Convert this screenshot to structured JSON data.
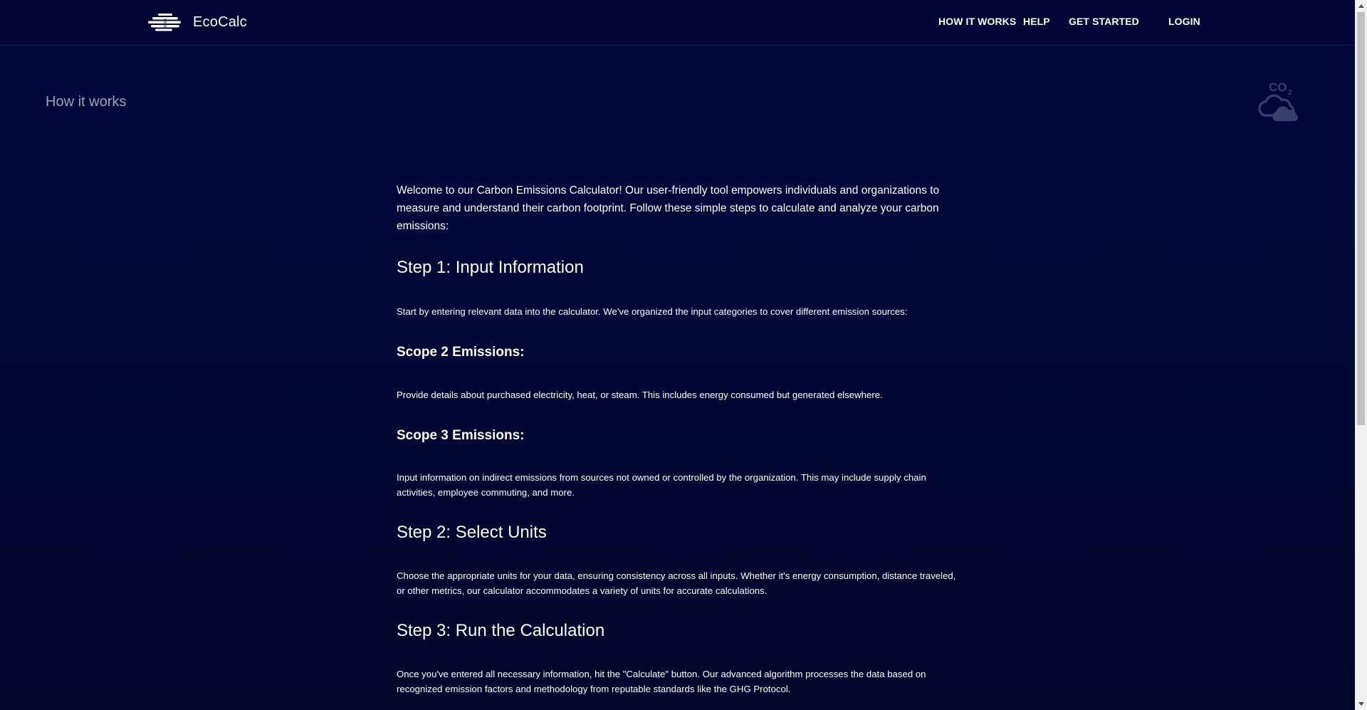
{
  "header": {
    "brand": "EcoCalc",
    "nav": {
      "how_it_works": "HOW IT WORKS",
      "help": "HELP",
      "get_started": "GET STARTED",
      "login": "LOGIN"
    }
  },
  "page": {
    "label": "How it works",
    "icon": "co2-cloud-icon",
    "co2_text": "CO",
    "co2_sub": "2"
  },
  "content": {
    "intro": "Welcome to our Carbon Emissions Calculator! Our user-friendly tool empowers individuals and organizations to measure and understand their carbon footprint. Follow these simple steps to calculate and analyze your carbon emissions:",
    "step1_title": "Step 1: Input Information",
    "step1_text": "Start by entering relevant data into the calculator. We've organized the input categories to cover different emission sources:",
    "scope2_title": "Scope 2 Emissions:",
    "scope2_text": "Provide details about purchased electricity, heat, or steam. This includes energy consumed but generated elsewhere.",
    "scope3_title": "Scope 3 Emissions:",
    "scope3_text": "Input information on indirect emissions from sources not owned or controlled by the organization. This may include supply chain activities, employee commuting, and more.",
    "step2_title": "Step 2: Select Units",
    "step2_text": "Choose the appropriate units for your data, ensuring consistency across all inputs. Whether it's energy consumption, distance traveled, or other metrics, our calculator accommodates a variety of units for accurate calculations.",
    "step3_title": "Step 3: Run the Calculation",
    "step3_text": "Once you've entered all necessary information, hit the \"Calculate\" button. Our advanced algorithm processes the data based on recognized emission factors and methodology from reputable standards like the GHG Protocol."
  },
  "colors": {
    "background": "#03063d",
    "header": "#020535",
    "muted_text": "#9ea2b6",
    "icon": "#3b3f6e"
  }
}
